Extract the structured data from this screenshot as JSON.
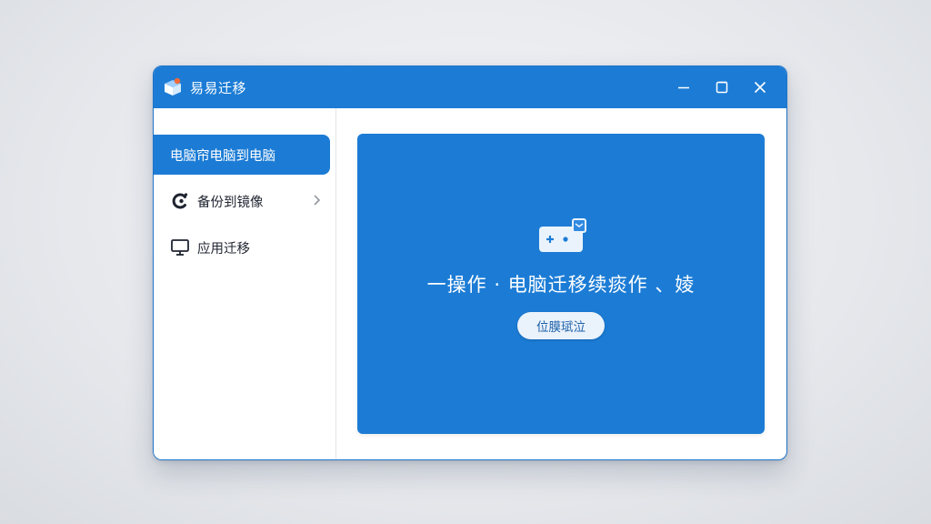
{
  "window": {
    "title": "易易迁移",
    "controls": {
      "minimize_icon": "minimize-icon",
      "maximize_icon": "maximize-icon",
      "close_icon": "close-icon"
    }
  },
  "sidebar": {
    "items": [
      {
        "label": "电脑帘电脑到电脑",
        "icon": "none",
        "active": true
      },
      {
        "label": "备份到镜像",
        "icon": "backup-c-icon",
        "has_chevron": true,
        "active": false
      },
      {
        "label": "应用迁移",
        "icon": "monitor-icon",
        "active": false
      }
    ]
  },
  "main": {
    "hero_icon": "transfer-device-icon",
    "title": "一操作 · 电脑迁移续痰作 、婈",
    "start_button_label": "位膜珷泣"
  },
  "colors": {
    "accent": "#1c7cd5",
    "titlebar": "#1c7cd5",
    "background": "#e6e8ec",
    "button_bg": "#eaf2fb",
    "button_text": "#1c5fa8"
  }
}
